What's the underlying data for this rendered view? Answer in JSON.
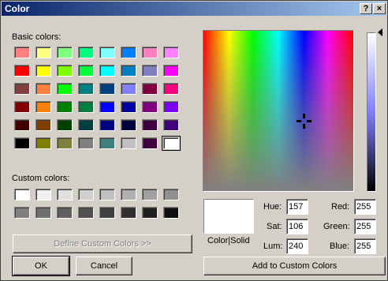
{
  "window": {
    "title": "Color",
    "help_label": "?",
    "close_label": "×"
  },
  "basic_colors": {
    "label": "Basic colors:",
    "rows": [
      [
        "#ff8080",
        "#ffff80",
        "#80ff80",
        "#00ff80",
        "#80ffff",
        "#0080ff",
        "#ff80c0",
        "#ff80ff"
      ],
      [
        "#ff0000",
        "#ffff00",
        "#80ff00",
        "#00ff40",
        "#00ffff",
        "#0080c0",
        "#8080c0",
        "#ff00ff"
      ],
      [
        "#804040",
        "#ff8040",
        "#00ff00",
        "#008080",
        "#004080",
        "#8080ff",
        "#800040",
        "#ff0080"
      ],
      [
        "#800000",
        "#ff8000",
        "#008000",
        "#008040",
        "#0000ff",
        "#0000a0",
        "#800080",
        "#8000ff"
      ],
      [
        "#400000",
        "#804000",
        "#004000",
        "#004040",
        "#000080",
        "#000040",
        "#400040",
        "#400080"
      ],
      [
        "#000000",
        "#808000",
        "#808040",
        "#808080",
        "#408080",
        "#c0c0c0",
        "#400040",
        "#ffffff"
      ]
    ]
  },
  "custom_colors": {
    "label": "Custom colors:",
    "rows": [
      [
        "#ffffff",
        "#f0f0f0",
        "#e0e0e0",
        "#d0d0d0",
        "#c0c0c0",
        "#b0b0b0",
        "#a0a0a0",
        "#909090"
      ],
      [
        "#808080",
        "#707070",
        "#606060",
        "#505050",
        "#404040",
        "#303030",
        "#202020",
        "#101010"
      ]
    ]
  },
  "define_button": "Define Custom Colors >>",
  "ok_button": "OK",
  "cancel_button": "Cancel",
  "preview_label": "Color|Solid",
  "hsl": {
    "hue_label": "Hue:",
    "hue": "157",
    "sat_label": "Sat:",
    "sat": "106",
    "lum_label": "Lum:",
    "lum": "240"
  },
  "rgb": {
    "red_label": "Red:",
    "red": "255",
    "green_label": "Green:",
    "green": "255",
    "blue_label": "Blue:",
    "blue": "255"
  },
  "add_button": "Add to Custom Colors",
  "preview_color": "#ffffff"
}
